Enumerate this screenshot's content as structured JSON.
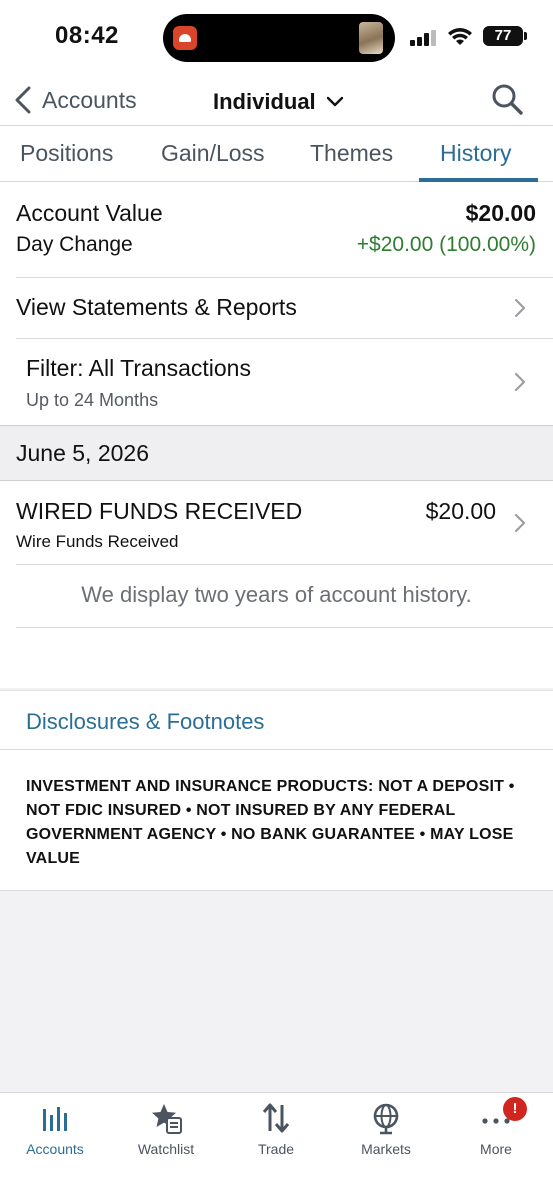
{
  "status_bar": {
    "time": "08:42",
    "battery": "77",
    "icons": [
      "app-notification-icon",
      "photo-thumbnail-icon",
      "cellular-signal-icon",
      "wifi-icon",
      "battery-icon"
    ]
  },
  "nav": {
    "back_label": "Accounts",
    "account_name": "Individual",
    "icons": [
      "chevron-left-icon",
      "chevron-down-icon",
      "search-icon"
    ]
  },
  "tabs": [
    {
      "label": "Positions",
      "active": false
    },
    {
      "label": "Gain/Loss",
      "active": false
    },
    {
      "label": "Themes",
      "active": false
    },
    {
      "label": "History",
      "active": true
    }
  ],
  "summary": {
    "account_value_label": "Account Value",
    "account_value": "$20.00",
    "day_change_label": "Day Change",
    "day_change": "+$20.00 (100.00%)",
    "positive_color": "#2e7d32"
  },
  "statements": {
    "label": "View Statements & Reports"
  },
  "filter": {
    "label": "Filter: All Transactions",
    "sub": "Up to 24 Months"
  },
  "transactions": {
    "date": "June 5, 2026",
    "items": [
      {
        "title": "WIRED FUNDS RECEIVED",
        "sub": "Wire Funds Received",
        "amount": "$20.00"
      }
    ],
    "note": "We display two years of account history."
  },
  "disclosures": {
    "link": "Disclosures & Footnotes",
    "text": "INVESTMENT AND INSURANCE PRODUCTS: NOT A DEPOSIT • NOT FDIC INSURED • NOT INSURED BY ANY FEDERAL GOVERNMENT AGENCY • NO BANK GUARANTEE • MAY LOSE VALUE"
  },
  "tabbar": {
    "items": [
      {
        "label": "Accounts",
        "icon": "accounts-bars-icon",
        "active": true
      },
      {
        "label": "Watchlist",
        "icon": "watchlist-star-icon",
        "active": false
      },
      {
        "label": "Trade",
        "icon": "trade-arrows-icon",
        "active": false
      },
      {
        "label": "Markets",
        "icon": "markets-globe-icon",
        "active": false
      },
      {
        "label": "More",
        "icon": "more-dots-icon",
        "active": false,
        "badge": "!"
      }
    ]
  },
  "colors": {
    "accent": "#2b6e95",
    "badge": "#d0261f"
  }
}
